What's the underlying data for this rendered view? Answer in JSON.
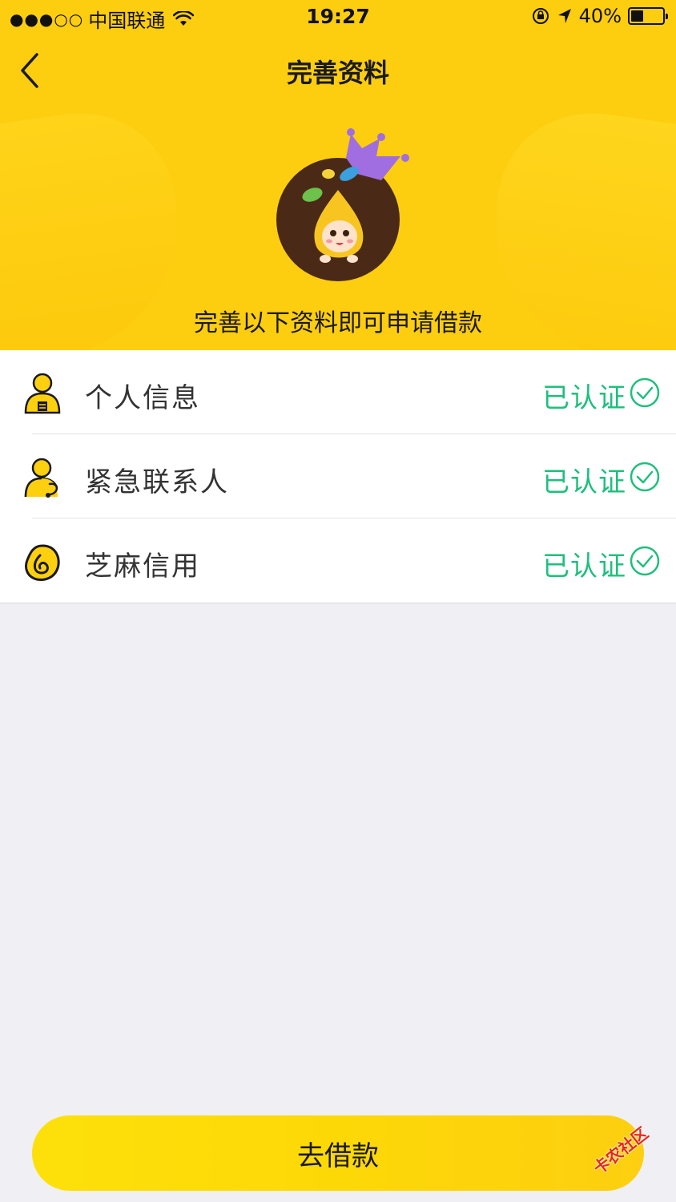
{
  "status_bar": {
    "signal": "●●●○○",
    "carrier": "中国联通",
    "time": "19:27",
    "battery_percent": "40%",
    "battery_level": 0.4
  },
  "nav": {
    "title": "完善资料"
  },
  "banner": {
    "subtitle": "完善以下资料即可申请借款"
  },
  "items": [
    {
      "label": "个人信息",
      "status": "已认证",
      "icon": "person-id-icon"
    },
    {
      "label": "紧急联系人",
      "status": "已认证",
      "icon": "person-phone-icon"
    },
    {
      "label": "芝麻信用",
      "status": "已认证",
      "icon": "sesame-credit-icon"
    }
  ],
  "cta": {
    "label": "去借款"
  },
  "watermark": {
    "text": "卡农社区"
  },
  "colors": {
    "header_bg": "#fdcd10",
    "verified_green": "#1fbf7d",
    "page_bg": "#efeff4",
    "cta_yellow": "#fdd807"
  }
}
